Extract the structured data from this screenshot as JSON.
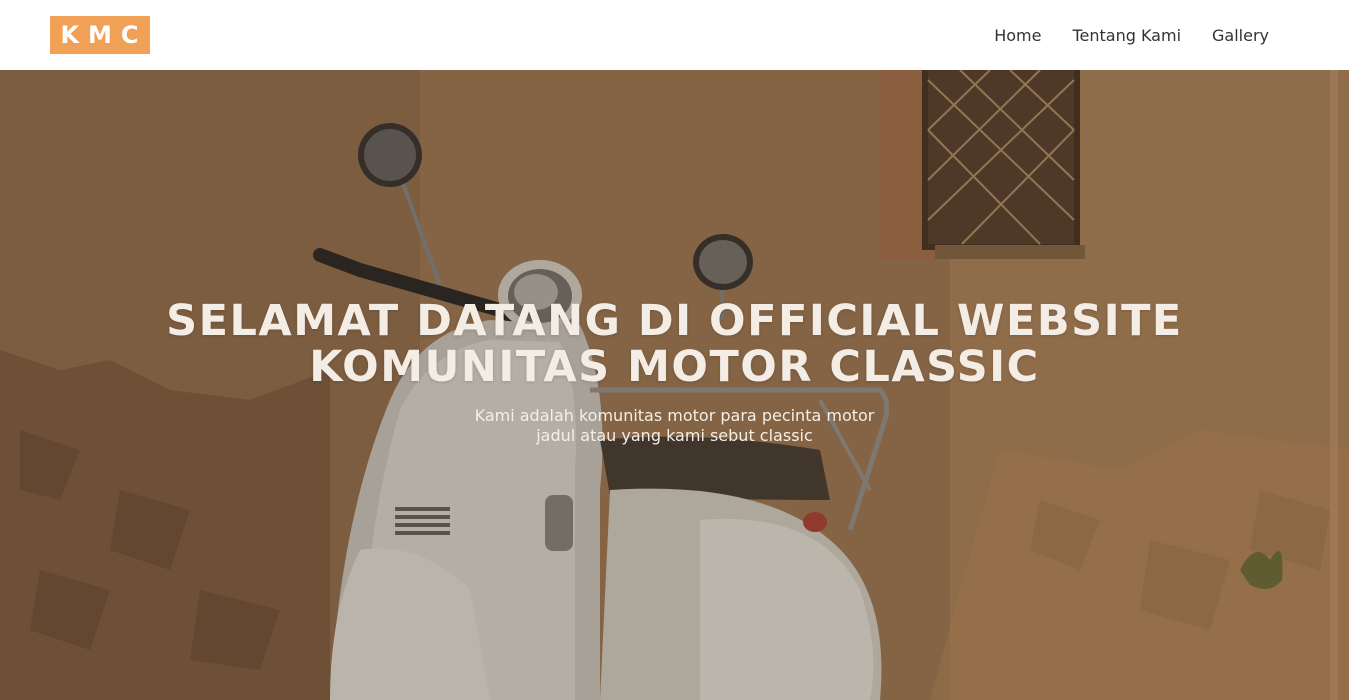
{
  "header": {
    "logo_text": "KMC",
    "nav": [
      {
        "label": "Home"
      },
      {
        "label": "Tentang Kami"
      },
      {
        "label": "Gallery"
      }
    ]
  },
  "hero": {
    "title_line1": "SELAMAT DATANG DI OFFICIAL WEBSITE",
    "title_line2": "KOMUNITAS MOTOR CLASSIC",
    "subtitle_line1": "Kami adalah komunitas motor para pecinta motor",
    "subtitle_line2": "jadul atau yang kami sebut classic",
    "background_image": "vintage-white-scooter-against-weathered-wall"
  },
  "colors": {
    "logo_bg": "#f0a155",
    "logo_text": "#ffffff",
    "nav_text": "#333333",
    "hero_text": "#f3ede6",
    "wall": "#a9845c"
  }
}
